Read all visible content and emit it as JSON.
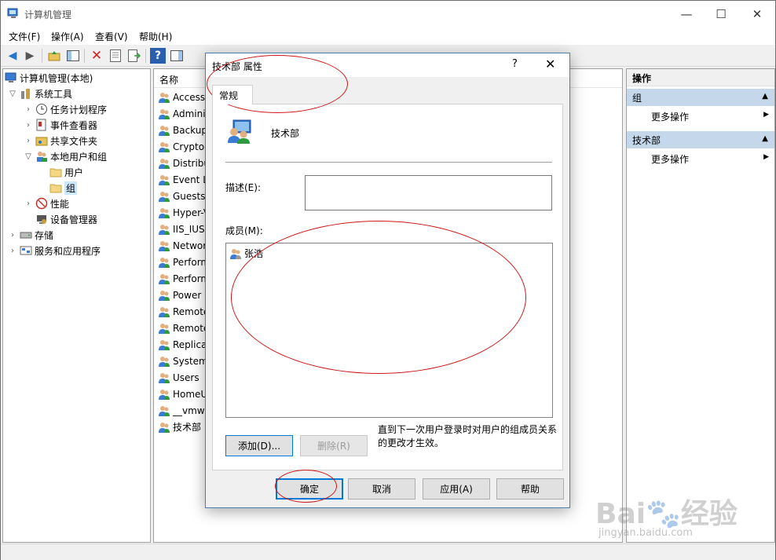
{
  "app": {
    "title": "计算机管理",
    "window_buttons": {
      "minimize": "—",
      "maximize": "☐",
      "close": "✕"
    }
  },
  "menu": [
    "文件(F)",
    "操作(A)",
    "查看(V)",
    "帮助(H)"
  ],
  "tree": {
    "root": "计算机管理(本地)",
    "system_tools": "系统工具",
    "task_scheduler": "任务计划程序",
    "event_viewer": "事件查看器",
    "shared_folders": "共享文件夹",
    "local_users_groups": "本地用户和组",
    "users": "用户",
    "groups": "组",
    "performance": "性能",
    "device_manager": "设备管理器",
    "storage": "存储",
    "services_apps": "服务和应用程序"
  },
  "list": {
    "column_name": "名称",
    "rows": [
      "Access",
      "Adminis",
      "Backup",
      "Cryptog",
      "Distribu",
      "Event Lo",
      "Guests",
      "Hyper-V",
      "IIS_IUSR",
      "Networ",
      "Perform",
      "Perform",
      "Power U",
      "Remote",
      "Remote",
      "Replicat",
      "System",
      "Users",
      "HomeU",
      "__vmwa",
      "技术部"
    ]
  },
  "actions": {
    "header": "操作",
    "section1": "组",
    "more1": "更多操作",
    "section2": "技术部",
    "more2": "更多操作"
  },
  "dialog": {
    "title": "技术部 属性",
    "help_glyph": "?",
    "close_glyph": "✕",
    "tab_general": "常规",
    "group_name": "技术部",
    "description_label": "描述(E):",
    "description_value": "",
    "members_label": "成员(M):",
    "members": [
      "张浩"
    ],
    "add_button": "添加(D)...",
    "remove_button": "删除(R)",
    "note": "直到下一次用户登录时对用户的组成员关系的更改才生效。",
    "ok_button": "确定",
    "cancel_button": "取消",
    "apply_button": "应用(A)",
    "help_button": "帮助"
  },
  "watermark": {
    "logo": "Bai🐾经验",
    "url": "jingyan.baidu.com"
  },
  "colors": {
    "selection": "#cce8ff",
    "action_section": "#c5d7ea",
    "annotation": "#d01818",
    "default_button_border": "#0078d7"
  }
}
